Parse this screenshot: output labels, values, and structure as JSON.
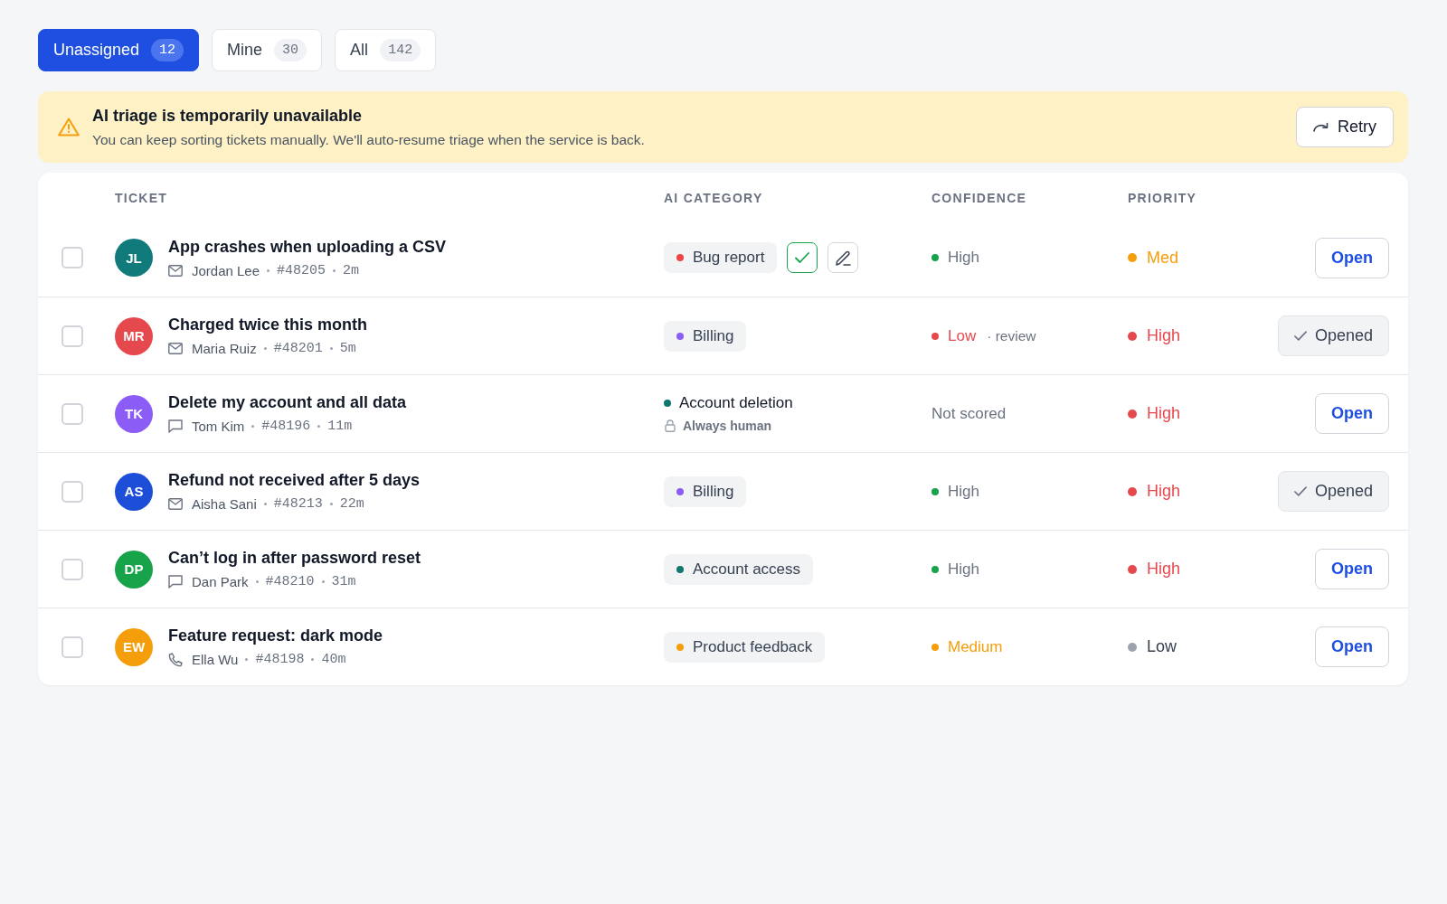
{
  "tabs": [
    {
      "label": "Unassigned",
      "count": "12",
      "selected": true
    },
    {
      "label": "Mine",
      "count": "30",
      "selected": false
    },
    {
      "label": "All",
      "count": "142",
      "selected": false
    }
  ],
  "banner": {
    "title": "AI triage is temporarily unavailable",
    "message": "You can keep sorting tickets manually. We'll auto-resume triage when the service is back.",
    "action": "Retry"
  },
  "table": {
    "columns": [
      "TICKET",
      "AI CATEGORY",
      "CONFIDENCE",
      "PRIORITY"
    ],
    "rows": [
      {
        "checked": false,
        "avatar": {
          "initials": "JL",
          "color": "#117a7a"
        },
        "title": "App crashes when uploading a CSV",
        "channel": {
          "kind": "email"
        },
        "requester": "Jordan Lee",
        "ticket_id": "#48205",
        "age": "2m",
        "category": {
          "kind": "suggested",
          "label": "Bug report",
          "color": "#ef4444"
        },
        "confidence": {
          "kind": "scored",
          "label": "High",
          "color": "#16a34a",
          "emphasized": false
        },
        "priority": {
          "label": "Med",
          "color": "#f59e0b",
          "emphasized": true
        },
        "action": {
          "label": "Open",
          "opened": false
        }
      },
      {
        "checked": false,
        "avatar": {
          "initials": "MR",
          "color": "#e5484d"
        },
        "title": "Charged twice this month",
        "channel": {
          "kind": "email"
        },
        "requester": "Maria Ruiz",
        "ticket_id": "#48201",
        "age": "5m",
        "category": {
          "kind": "chip",
          "label": "Billing",
          "color": "#8b5cf6"
        },
        "confidence": {
          "kind": "scored",
          "label": "Low",
          "color": "#e5484d",
          "emphasized": true,
          "note": "· review"
        },
        "priority": {
          "label": "High",
          "color": "#e5484d",
          "emphasized": true
        },
        "action": {
          "label": "Opened",
          "opened": true
        }
      },
      {
        "checked": false,
        "avatar": {
          "initials": "TK",
          "color": "#8b5cf6"
        },
        "title": "Delete my account and all data",
        "channel": {
          "kind": "chat"
        },
        "requester": "Tom Kim",
        "ticket_id": "#48196",
        "age": "11m",
        "category": {
          "kind": "locked",
          "label": "Account deletion",
          "color": "#0f766e",
          "note": "Always human"
        },
        "confidence": {
          "kind": "none",
          "label": "Not scored"
        },
        "priority": {
          "label": "High",
          "color": "#e5484d",
          "emphasized": true
        },
        "action": {
          "label": "Open",
          "opened": false
        }
      },
      {
        "checked": false,
        "avatar": {
          "initials": "AS",
          "color": "#1d4ed8"
        },
        "title": "Refund not received after 5 days",
        "channel": {
          "kind": "email"
        },
        "requester": "Aisha Sani",
        "ticket_id": "#48213",
        "age": "22m",
        "category": {
          "kind": "chip",
          "label": "Billing",
          "color": "#8b5cf6"
        },
        "confidence": {
          "kind": "scored",
          "label": "High",
          "color": "#16a34a",
          "emphasized": false
        },
        "priority": {
          "label": "High",
          "color": "#e5484d",
          "emphasized": true
        },
        "action": {
          "label": "Opened",
          "opened": true
        }
      },
      {
        "checked": false,
        "avatar": {
          "initials": "DP",
          "color": "#16a34a"
        },
        "title": "Can’t log in after password reset",
        "channel": {
          "kind": "chat"
        },
        "requester": "Dan Park",
        "ticket_id": "#48210",
        "age": "31m",
        "category": {
          "kind": "chip",
          "label": "Account access",
          "color": "#0f766e"
        },
        "confidence": {
          "kind": "scored",
          "label": "High",
          "color": "#16a34a",
          "emphasized": false
        },
        "priority": {
          "label": "High",
          "color": "#e5484d",
          "emphasized": true
        },
        "action": {
          "label": "Open",
          "opened": false
        }
      },
      {
        "checked": false,
        "avatar": {
          "initials": "EW",
          "color": "#f59e0b"
        },
        "title": "Feature request: dark mode",
        "channel": {
          "kind": "phone"
        },
        "requester": "Ella Wu",
        "ticket_id": "#48198",
        "age": "40m",
        "category": {
          "kind": "chip",
          "label": "Product feedback",
          "color": "#f59e0b"
        },
        "confidence": {
          "kind": "scored",
          "label": "Medium",
          "color": "#f59e0b",
          "emphasized": true
        },
        "priority": {
          "label": "Low",
          "color": "#9ca3af",
          "emphasized": false
        },
        "action": {
          "label": "Open",
          "opened": false
        }
      }
    ]
  }
}
